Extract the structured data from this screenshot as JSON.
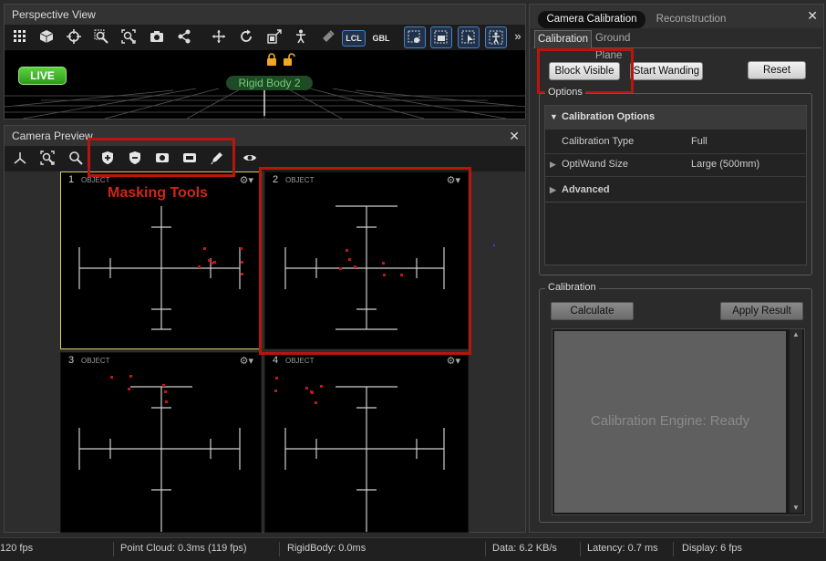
{
  "perspective": {
    "title": "Perspective View",
    "live_label": "LIVE",
    "lcl_label": "LCL",
    "gbl_label": "GBL",
    "rigid_body_label": "Rigid Body 2",
    "more_label": "»",
    "toolbar_icons": [
      "grid-icon",
      "cube-icon",
      "crosshair-icon",
      "zoom-region-icon",
      "zoom-fit-icon",
      "camera-icon",
      "network-icon",
      "translate-icon",
      "rotate-icon",
      "scale-icon",
      "skeleton-icon",
      "lock-icon"
    ]
  },
  "preview": {
    "title": "Camera Preview",
    "annotation_label": "Masking Tools",
    "toolbar_icons": [
      "axes-icon",
      "zoom-fit-icon",
      "zoom-icon",
      "mask-shield-add-icon",
      "mask-shield-remove-icon",
      "mask-circle-icon",
      "mask-rect-icon",
      "mask-pencil-icon",
      "eye-icon"
    ],
    "cameras": [
      {
        "num": "1",
        "mode": "OBJECT"
      },
      {
        "num": "2",
        "mode": "OBJECT"
      },
      {
        "num": "3",
        "mode": "OBJECT"
      },
      {
        "num": "4",
        "mode": "OBJECT"
      }
    ]
  },
  "calibration_panel": {
    "tabs": [
      "Camera Calibration",
      "Reconstruction"
    ],
    "subtabs": [
      "Calibration",
      "Ground Plane"
    ],
    "buttons": {
      "block_visible": "Block Visible",
      "start_wanding": "Start Wanding",
      "reset": "Reset"
    },
    "options_group": "Options",
    "calibration_options_header": "Calibration Options",
    "rows": [
      {
        "label": "Calibration Type",
        "value": "Full"
      },
      {
        "label": "OptiWand Size",
        "value": "Large (500mm)"
      }
    ],
    "advanced_label": "Advanced",
    "calibration_group": "Calibration",
    "calculate_label": "Calculate",
    "apply_result_label": "Apply Result",
    "engine_status": "Calibration Engine: Ready"
  },
  "status_bar": {
    "fps": "120 fps",
    "point_cloud": "Point Cloud: 0.3ms (119 fps)",
    "rigid_body": "RigidBody: 0.0ms",
    "data": "Data: 6.2 KB/s",
    "latency": "Latency: 0.7 ms",
    "display": "Display: 6 fps"
  },
  "colors": {
    "live_green": "#3fae2a",
    "annotation_red": "#b8160c",
    "marker_red": "#c41616",
    "selected_border": "#d8d060"
  }
}
